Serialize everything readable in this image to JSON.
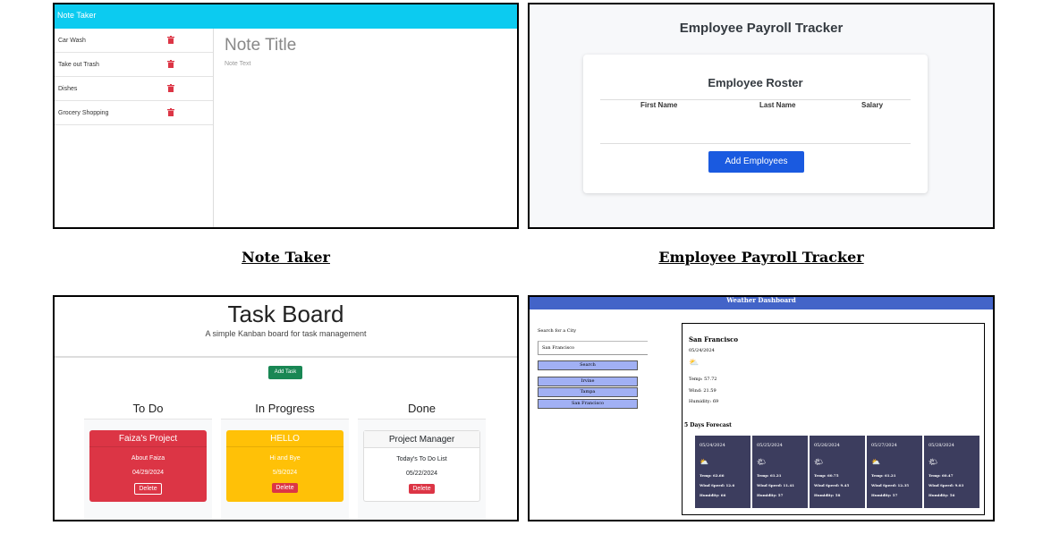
{
  "captions": {
    "note": "Note Taker",
    "payroll": "Employee Payroll Tracker"
  },
  "note_taker": {
    "title": "Note Taker",
    "notes": [
      {
        "label": "Car Wash"
      },
      {
        "label": "Take out Trash"
      },
      {
        "label": "Dishes"
      },
      {
        "label": "Grocery Shopping"
      }
    ],
    "note_title_placeholder": "Note Title",
    "note_text_placeholder": "Note Text",
    "trash_color": "#dc3545"
  },
  "payroll": {
    "title": "Employee Payroll Tracker",
    "roster_title": "Employee Roster",
    "columns": [
      "First Name",
      "Last Name",
      "Salary"
    ],
    "add_button": "Add Employees"
  },
  "task_board": {
    "title": "Task Board",
    "subtitle": "A simple Kanban board for task management",
    "add_button": "Add Task",
    "columns": [
      {
        "title": "To Do",
        "card": {
          "title": "Faiza's Project",
          "desc": "About Faiza",
          "date": "04/29/2024",
          "delete": "Delete",
          "bg": "#dc3545",
          "fg": "#ffffff"
        }
      },
      {
        "title": "In Progress",
        "card": {
          "title": "HELLO",
          "desc": "Hi and Bye",
          "date": "5/9/2024",
          "delete": "Delete",
          "bg": "#ffc107",
          "fg": "#ffffff"
        }
      },
      {
        "title": "Done",
        "card": {
          "title": "Project Manager",
          "desc": "Today's To Do List",
          "date": "05/22/2024",
          "delete": "Delete",
          "bg": "#ffffff",
          "fg": "#212529"
        }
      }
    ]
  },
  "weather": {
    "title": "Weather Dashboard",
    "search_label": "Search for a City",
    "search_value": "San Francisco",
    "search_button": "Search",
    "history": [
      "Irvine",
      "Tampa",
      "San Francisco"
    ],
    "current": {
      "city": "San Francisco",
      "date": "05/24/2024",
      "icon": "partly-cloudy-icon",
      "temp": "Temp: 57.72",
      "wind": "Wind: 21.59",
      "humidity": "Humidity: 69"
    },
    "forecast_title": "5 Days Forecast",
    "forecast": [
      {
        "date": "05/24/2024",
        "icon": "⛅",
        "temp": "Temp: 62.66",
        "wind": "Wind Speed: 12.6",
        "humidity": "Humidity: 66"
      },
      {
        "date": "05/25/2024",
        "icon": "🌤",
        "temp": "Temp: 61.21",
        "wind": "Wind Speed: 11.41",
        "humidity": "Humidity: 57"
      },
      {
        "date": "05/26/2024",
        "icon": "🌤",
        "temp": "Temp: 60.75",
        "wind": "Wind Speed: 9.45",
        "humidity": "Humidity: 58"
      },
      {
        "date": "05/27/2024",
        "icon": "⛅",
        "temp": "Temp: 61.21",
        "wind": "Wind Speed: 12.35",
        "humidity": "Humidity: 57"
      },
      {
        "date": "05/28/2024",
        "icon": "🌤",
        "temp": "Temp: 60.47",
        "wind": "Wind Speed: 9.03",
        "humidity": "Humidity: 56"
      }
    ]
  }
}
